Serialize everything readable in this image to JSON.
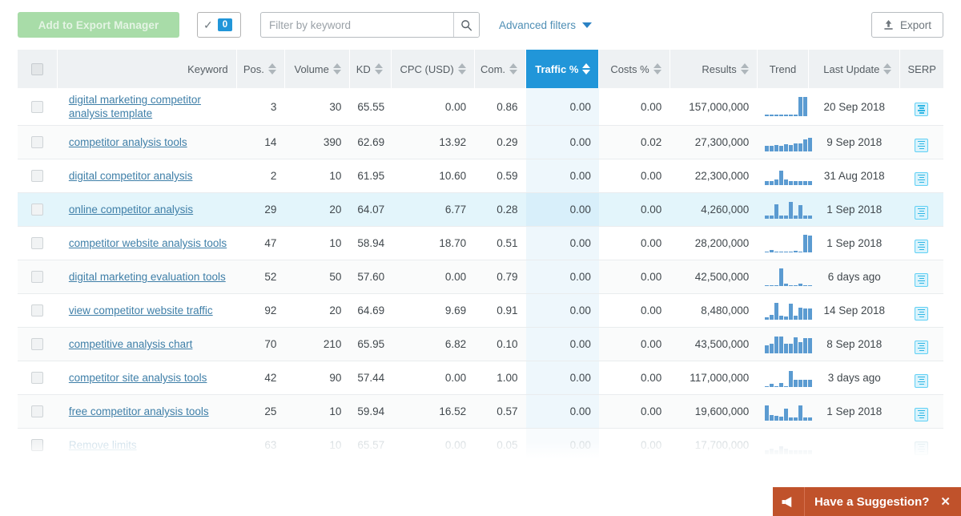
{
  "toolbar": {
    "export_manager_label": "Add to Export Manager",
    "selected_count": "0",
    "check_icon": "check-icon",
    "filter_placeholder": "Filter by keyword",
    "filter_value": "",
    "search_icon": "search-icon",
    "advanced_filters_label": "Advanced filters",
    "chevron_icon": "chevron-down-icon",
    "export_label": "Export",
    "upload_icon": "upload-icon"
  },
  "colors": {
    "accent_blue": "#2196d9",
    "header_bg": "#eef1f3",
    "link_blue": "#3f7fa8",
    "spark_blue": "#5b9bd1",
    "serp_cyan": "#2fb6e4",
    "suggest_orange": "#c0522b",
    "disabled_green": "#a8dca8"
  },
  "table": {
    "columns": [
      {
        "key": "chk",
        "label": "",
        "sortable": false
      },
      {
        "key": "keyword",
        "label": "Keyword",
        "sortable": false
      },
      {
        "key": "pos",
        "label": "Pos.",
        "sortable": true
      },
      {
        "key": "volume",
        "label": "Volume",
        "sortable": true
      },
      {
        "key": "kd",
        "label": "KD",
        "sortable": true
      },
      {
        "key": "cpc",
        "label": "CPC (USD)",
        "sortable": true
      },
      {
        "key": "com",
        "label": "Com.",
        "sortable": true
      },
      {
        "key": "traffic",
        "label": "Traffic %",
        "sortable": true,
        "active": true
      },
      {
        "key": "costs",
        "label": "Costs %",
        "sortable": true
      },
      {
        "key": "results",
        "label": "Results",
        "sortable": true
      },
      {
        "key": "trend",
        "label": "Trend",
        "sortable": false
      },
      {
        "key": "update",
        "label": "Last Update",
        "sortable": true
      },
      {
        "key": "serp",
        "label": "SERP",
        "sortable": false
      }
    ],
    "rows": [
      {
        "keyword": "digital marketing competitor analysis template",
        "pos": "3",
        "volume": "30",
        "kd": "65.55",
        "cpc": "0.00",
        "com": "0.86",
        "traffic": "0.00",
        "costs": "0.00",
        "results": "157,000,000",
        "update": "20 Sep 2018",
        "trend": [
          0,
          0,
          0,
          0,
          0,
          0,
          0,
          100,
          100
        ],
        "serp": "serp-icon",
        "state": "normal"
      },
      {
        "keyword": "competitor analysis tools",
        "pos": "14",
        "volume": "390",
        "kd": "62.69",
        "cpc": "13.92",
        "com": "0.29",
        "traffic": "0.00",
        "costs": "0.02",
        "results": "27,300,000",
        "update": "9 Sep 2018",
        "trend": [
          30,
          28,
          32,
          30,
          36,
          34,
          42,
          40,
          62,
          72
        ],
        "serp": "serp-icon",
        "state": "odd"
      },
      {
        "keyword": "digital competitor analysis",
        "pos": "2",
        "volume": "10",
        "kd": "61.95",
        "cpc": "10.60",
        "com": "0.59",
        "traffic": "0.00",
        "costs": "0.00",
        "results": "22,300,000",
        "update": "31 Aug 2018",
        "trend": [
          22,
          22,
          28,
          74,
          30,
          22,
          22,
          22,
          22,
          22
        ],
        "serp": "serp-icon",
        "state": "normal"
      },
      {
        "keyword": "online competitor analysis",
        "pos": "29",
        "volume": "20",
        "kd": "64.07",
        "cpc": "6.77",
        "com": "0.28",
        "traffic": "0.00",
        "costs": "0.00",
        "results": "4,260,000",
        "update": "1 Sep 2018",
        "trend": [
          16,
          16,
          74,
          16,
          16,
          86,
          16,
          70,
          16,
          16
        ],
        "serp": "serp-icon",
        "state": "hover"
      },
      {
        "keyword": "competitor website analysis tools",
        "pos": "47",
        "volume": "10",
        "kd": "58.94",
        "cpc": "18.70",
        "com": "0.51",
        "traffic": "0.00",
        "costs": "0.00",
        "results": "28,200,000",
        "update": "1 Sep 2018",
        "trend": [
          0,
          12,
          0,
          6,
          0,
          0,
          10,
          0,
          90,
          88
        ],
        "serp": "serp-icon",
        "state": "normal"
      },
      {
        "keyword": "digital marketing evaluation tools",
        "pos": "52",
        "volume": "50",
        "kd": "57.60",
        "cpc": "0.00",
        "com": "0.79",
        "traffic": "0.00",
        "costs": "0.00",
        "results": "42,500,000",
        "update": "6 days ago",
        "trend": [
          0,
          0,
          0,
          90,
          12,
          0,
          0,
          14,
          0,
          0
        ],
        "serp": "serp-icon",
        "state": "odd"
      },
      {
        "keyword": "view competitor website traffic",
        "pos": "92",
        "volume": "20",
        "kd": "64.69",
        "cpc": "9.69",
        "com": "0.91",
        "traffic": "0.00",
        "costs": "0.00",
        "results": "8,480,000",
        "update": "14 Sep 2018",
        "trend": [
          14,
          26,
          86,
          20,
          18,
          84,
          20,
          62,
          60,
          58
        ],
        "serp": "serp-icon",
        "state": "normal"
      },
      {
        "keyword": "competitive analysis chart",
        "pos": "70",
        "volume": "210",
        "kd": "65.95",
        "cpc": "6.82",
        "com": "0.10",
        "traffic": "0.00",
        "costs": "0.00",
        "results": "43,500,000",
        "update": "8 Sep 2018",
        "trend": [
          40,
          52,
          86,
          86,
          52,
          52,
          82,
          58,
          80,
          78
        ],
        "serp": "serp-icon",
        "state": "odd"
      },
      {
        "keyword": "competitor site analysis tools",
        "pos": "42",
        "volume": "90",
        "kd": "57.44",
        "cpc": "0.00",
        "com": "1.00",
        "traffic": "0.00",
        "costs": "0.00",
        "results": "117,000,000",
        "update": "3 days ago",
        "trend": [
          0,
          18,
          0,
          20,
          0,
          82,
          36,
          36,
          36,
          36
        ],
        "serp": "serp-icon",
        "state": "normal"
      },
      {
        "keyword": "free competitor analysis tools",
        "pos": "25",
        "volume": "10",
        "kd": "59.94",
        "cpc": "16.52",
        "com": "0.57",
        "traffic": "0.00",
        "costs": "0.00",
        "results": "19,600,000",
        "update": "1 Sep 2018",
        "trend": [
          80,
          30,
          26,
          20,
          62,
          18,
          18,
          78,
          18,
          18
        ],
        "serp": "serp-icon",
        "state": "odd"
      },
      {
        "keyword": "Remove limits",
        "pos": "63",
        "volume": "10",
        "kd": "65.57",
        "cpc": "0.00",
        "com": "0.05",
        "traffic": "0.00",
        "costs": "0.00",
        "results": "17,700,000",
        "update": "",
        "trend": [
          20,
          30,
          20,
          40,
          30,
          20,
          20,
          20,
          20,
          20
        ],
        "serp": "serp-icon",
        "state": "faded"
      }
    ]
  },
  "suggestion": {
    "label": "Have a Suggestion?",
    "megaphone_icon": "megaphone-icon",
    "close_icon": "close-icon"
  }
}
